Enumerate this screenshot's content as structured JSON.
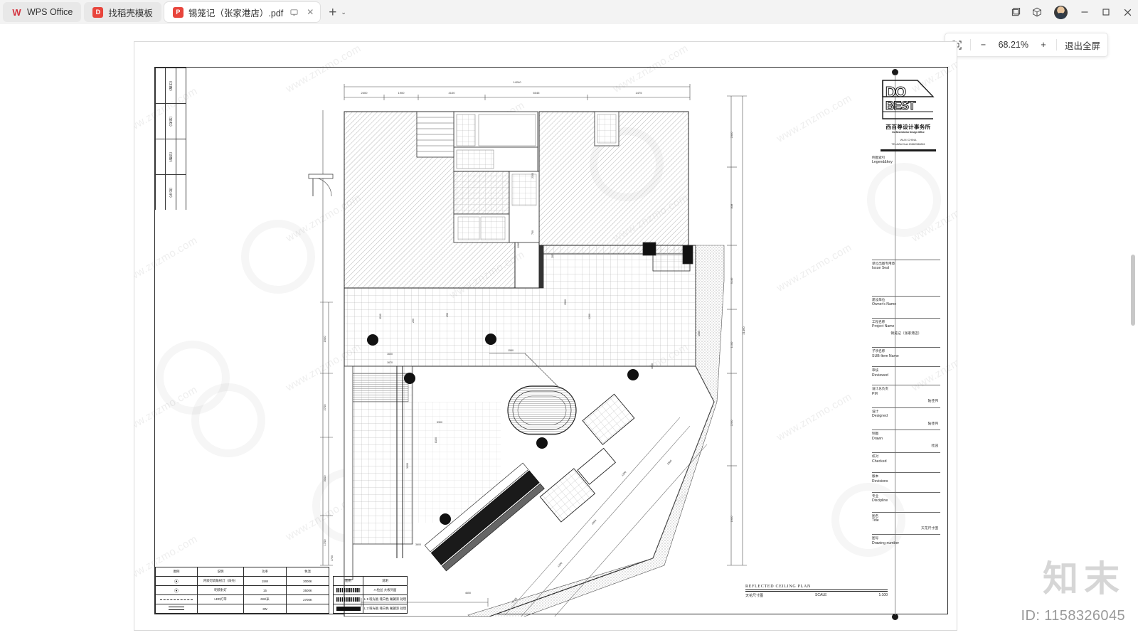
{
  "titlebar": {
    "tabs": [
      {
        "label": "WPS Office",
        "icon": "wps-icon",
        "active": false,
        "closable": false
      },
      {
        "label": "找稻壳模板",
        "icon": "template-icon",
        "active": false,
        "closable": false
      },
      {
        "label": "锡笼记（张家港店）.pdf",
        "icon": "pdf-icon",
        "active": true,
        "closable": true
      }
    ],
    "new_tab_label": "+",
    "new_tab_chevron": "⌄",
    "window_controls": [
      "split-view-icon",
      "cube-icon",
      "avatar",
      "minimize",
      "maximize",
      "close"
    ]
  },
  "zoombar": {
    "fit_icon": "fit-page-icon",
    "zoom_out_label": "−",
    "zoom_level": "68.21%",
    "zoom_in_label": "+",
    "exit_fullscreen_label": "退出全屏"
  },
  "titleblock": {
    "logo": {
      "mark_line1": "DO",
      "mark_line2": "BEST",
      "company_cn": "西百尊设计事务所",
      "company_en": "Do Best Interior Design Office",
      "city": "WUXI CHINA",
      "contact": "TEL&WeChat:15862988881"
    },
    "legend_key": {
      "cn": "例图索引",
      "en": "Legend&key"
    },
    "rows": [
      {
        "cn": "单位出图专用章",
        "en": "Issue Seal",
        "value": ""
      },
      {
        "cn": "建设单位",
        "en": "Owner's Name",
        "value": ""
      },
      {
        "cn": "工程名称",
        "en": "Project Name",
        "value": "锡笼记（张家港店）"
      },
      {
        "cn": "子项名称",
        "en": "SUB-Item Name",
        "value": ""
      },
      {
        "cn": "审核",
        "en": "Reviewed",
        "value": ""
      },
      {
        "cn": "设计总负责",
        "en": "PM",
        "value": "陆佳伟"
      },
      {
        "cn": "设计",
        "en": "Designed",
        "value": "陆佳伟"
      },
      {
        "cn": "制图",
        "en": "Drawn",
        "value": "杜园"
      },
      {
        "cn": "校对",
        "en": "Checked",
        "value": ""
      },
      {
        "cn": "版本",
        "en": "Revisions",
        "value": ""
      },
      {
        "cn": "专业",
        "en": "Discipline",
        "value": ""
      },
      {
        "cn": "图名",
        "en": "Title",
        "value": "天花尺寸图"
      },
      {
        "cn": "图号",
        "en": "Drawing number",
        "value": ""
      }
    ]
  },
  "legend_lighting": {
    "headers": [
      "图例",
      "说明",
      "功率",
      "色温"
    ],
    "rows": [
      {
        "symbol": "downlight-icon",
        "desc": "内嵌可调角射灯（白壳）",
        "power": "15W",
        "cct": "3000K"
      },
      {
        "symbol": "surface-spot-icon",
        "desc": "明装射灯",
        "power": "15",
        "cct": "3500K"
      },
      {
        "symbol": "led-strip-icon",
        "desc": "LED灯带",
        "power": "6W/米",
        "cct": "2700K"
      },
      {
        "symbol": "linear-light-icon",
        "desc": "",
        "power": "3W",
        "cct": ""
      }
    ]
  },
  "legend_material": {
    "headers": [
      "图例",
      "说明"
    ],
    "rows": [
      {
        "symbol": "black-bar-icon",
        "desc": "A:拉丝 大板列面"
      },
      {
        "symbol": "hatch-bar-icon",
        "desc": "L:1:哑光板 哑白色 氟藏漆 处理"
      },
      {
        "symbol": "solid-bar-icon",
        "desc": "L:2:哑光板 哑白色 氟藏漆 处理"
      }
    ]
  },
  "plan_caption": {
    "title_en": "REFLECTED CEILING PLAN",
    "title_cn": "天花尺寸图",
    "scale_label": "SCALE",
    "scale_value": "1:100"
  },
  "left_index": {
    "cells": [
      "（日期）",
      "（修改）",
      "（说明）",
      "（序号）"
    ]
  },
  "dimensions": {
    "top_chain": [
      "2400",
      "1900",
      "4100",
      "6045",
      "1475"
    ],
    "top_overall": "14240",
    "right_chain": [
      "2300",
      "700",
      "1100",
      "1500",
      "2060",
      "1900"
    ],
    "right_overall": "21460",
    "left_chain": [
      "1900",
      "2700",
      "3000",
      "1700"
    ],
    "misc": [
      "1600",
      "1670",
      "5300",
      "8100",
      "3000",
      "2900",
      "3300",
      "3600",
      "4650",
      "1550",
      "1800",
      "1000",
      "838",
      "3146",
      "2200",
      "2060"
    ]
  },
  "watermarks": {
    "tiles": "www.znzmo.com",
    "brand": "知末",
    "id": "ID: 1158326045"
  }
}
